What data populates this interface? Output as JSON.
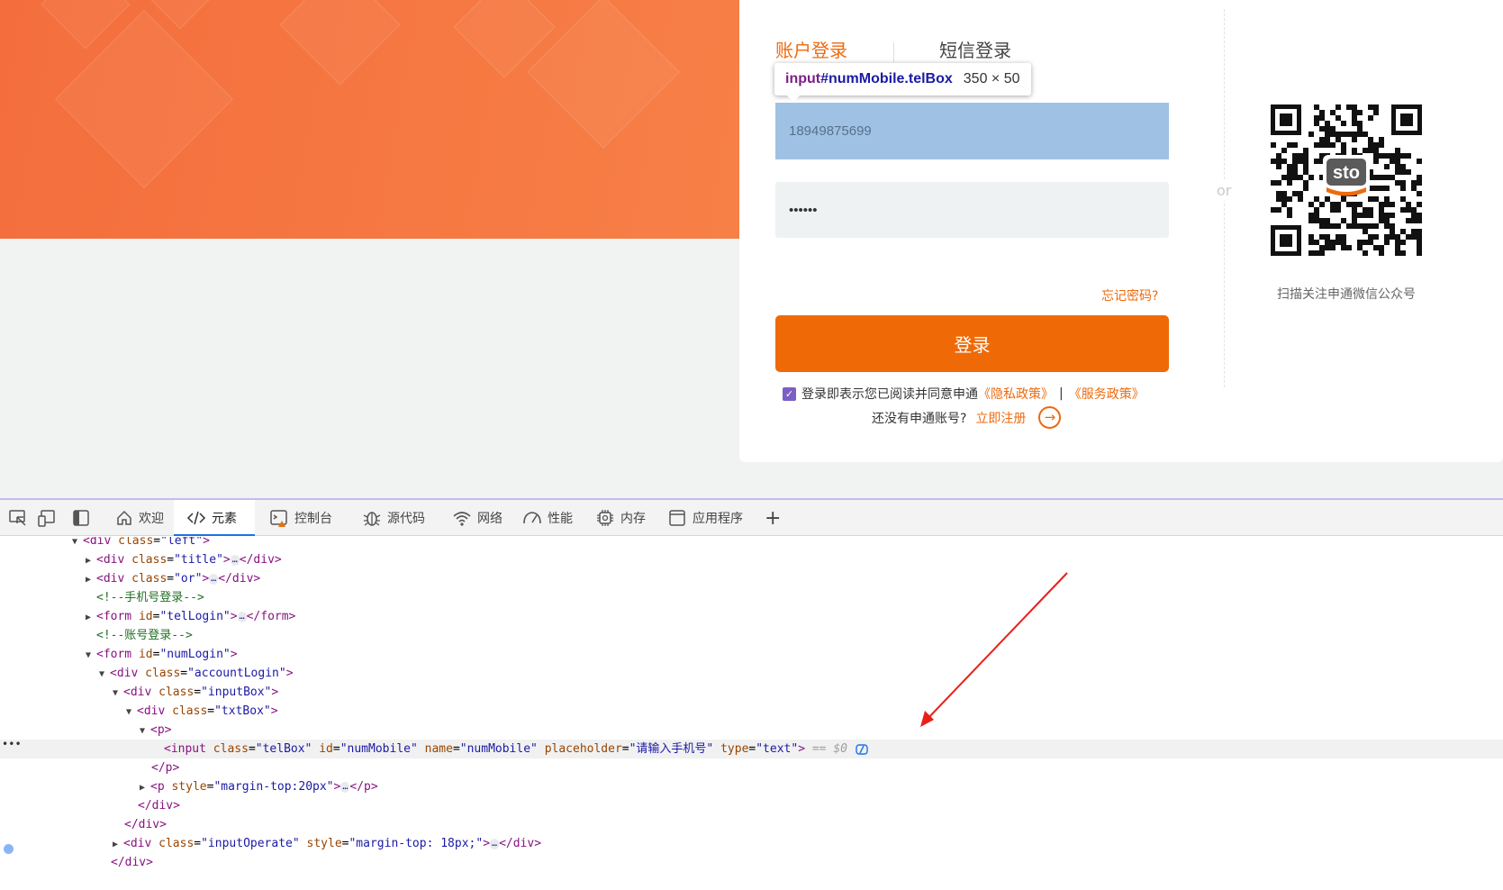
{
  "login": {
    "tabs": {
      "account": "账户登录",
      "sms": "短信登录"
    },
    "phone_value": "18949875699",
    "password_value": "••••••",
    "forgot_password": "忘记密码?",
    "login_button": "登录",
    "agreement": {
      "text": "登录即表示您已阅读并同意申通",
      "privacy": "《隐私政策》",
      "separator": "|",
      "service": "《服务政策》"
    },
    "register": {
      "prompt": "还没有申通账号?",
      "link": "立即注册"
    },
    "or_text": "or",
    "qr_caption": "扫描关注申通微信公众号",
    "qr_logo": "sto"
  },
  "inspect_tooltip": {
    "tag": "input",
    "selector": "#numMobile.telBox",
    "dimensions": "350 × 50"
  },
  "devtools": {
    "tabs": [
      {
        "label": "欢迎",
        "icon": "home-icon"
      },
      {
        "label": "元素",
        "icon": "code-icon"
      },
      {
        "label": "控制台",
        "icon": "console-icon"
      },
      {
        "label": "源代码",
        "icon": "bug-icon"
      },
      {
        "label": "网络",
        "icon": "wifi-icon"
      },
      {
        "label": "性能",
        "icon": "gauge-icon"
      },
      {
        "label": "内存",
        "icon": "chip-icon"
      },
      {
        "label": "应用程序",
        "icon": "window-icon"
      }
    ],
    "active_tab": "元素",
    "dom": {
      "l0_tag": "div",
      "l0_attr": "class",
      "l0_val": "\"left\"",
      "l1_tag": "div",
      "l1_attr": "class",
      "l1_val": "\"title\"",
      "l2_tag": "div",
      "l2_attr": "class",
      "l2_val": "\"or\"",
      "l3_comment": "<!--手机号登录-->",
      "l4_tag": "form",
      "l4_attr": "id",
      "l4_val": "\"telLogin\"",
      "l5_comment": "<!--账号登录-->",
      "l6_tag": "form",
      "l6_attr": "id",
      "l6_val": "\"numLogin\"",
      "l7_tag": "div",
      "l7_attr": "class",
      "l7_val": "\"accountLogin\"",
      "l8_tag": "div",
      "l8_attr": "class",
      "l8_val": "\"inputBox\"",
      "l9_tag": "div",
      "l9_attr": "class",
      "l9_val": "\"txtBox\"",
      "l10_tag": "p",
      "l11": {
        "tag": "input",
        "a1": "class",
        "v1": "\"telBox\"",
        "a2": "id",
        "v2": "\"numMobile\"",
        "a3": "name",
        "v3": "\"numMobile\"",
        "a4": "placeholder",
        "v4": "\"请输入手机号\"",
        "a5": "type",
        "v5": "\"text\"",
        "eq": "== $0"
      },
      "l12_close": "</p>",
      "l13_tag": "p",
      "l13_attr": "style",
      "l13_val": "\"margin-top:20px\"",
      "l14_close": "</div>",
      "l15_close": "</div>",
      "l16_tag": "div",
      "l16_a1": "class",
      "l16_v1": "\"inputOperate\"",
      "l16_a2": "style",
      "l16_v2": "\"margin-top: 18px;\"",
      "l17_close": "</div>",
      "ellipsis": "…"
    }
  },
  "colors": {
    "brand_orange": "#ef6a06",
    "hero_gradient_start": "#f46e3d",
    "highlight_blue": "#9fc2e4",
    "devtools_active": "#1a73e8",
    "arrow_red": "#e8201a"
  }
}
